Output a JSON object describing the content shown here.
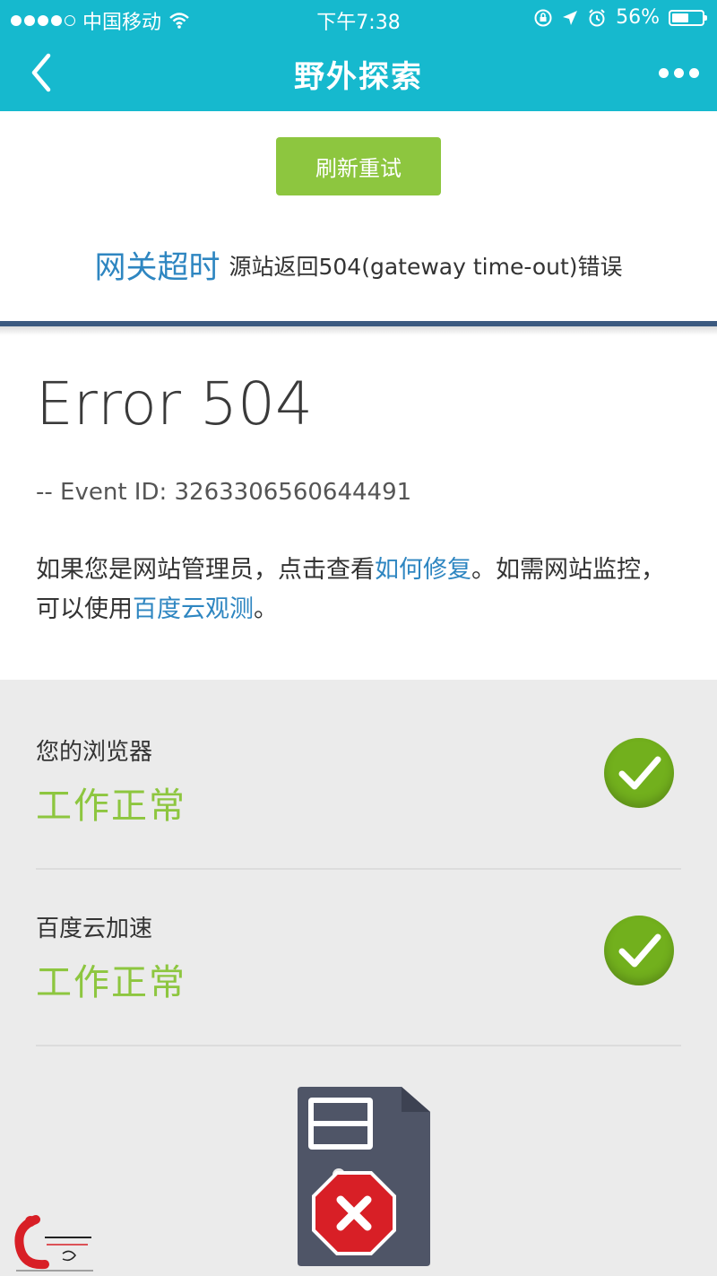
{
  "status_bar": {
    "carrier": "中国移动",
    "time": "下午7:38",
    "battery": "56%",
    "battery_level": 0.56,
    "signal_bars": 4,
    "icons": [
      "wifi-icon",
      "rotation-lock-icon",
      "location-arrow-icon",
      "alarm-icon",
      "battery-icon"
    ]
  },
  "nav": {
    "title": "野外探索",
    "back_icon": "chevron-left-icon",
    "more_icon": "more-dots-icon"
  },
  "refresh_button": "刷新重试",
  "gateway": {
    "title": "网关超时",
    "message": "源站返回504(gateway time-out)错误"
  },
  "error": {
    "title": "Error 504",
    "event_id": "-- Event ID: 3263306560644491",
    "desc_part1": "如果您是网站管理员，点击查看",
    "link_fix": "如何修复",
    "desc_part2": "。如需网站监控，可以使用",
    "link_monitor": "百度云观测",
    "desc_part3": "。"
  },
  "checks": [
    {
      "label": "您的浏览器",
      "status": "工作正常",
      "icon": "check-icon"
    },
    {
      "label": "百度云加速",
      "status": "工作正常",
      "icon": "check-icon"
    }
  ],
  "server_icon": "server-error-icon",
  "colors": {
    "header": "#16b9ce",
    "button": "#8dc63f",
    "link": "#2e86c1",
    "ok": "#8dc63f",
    "error": "#d81f26"
  }
}
